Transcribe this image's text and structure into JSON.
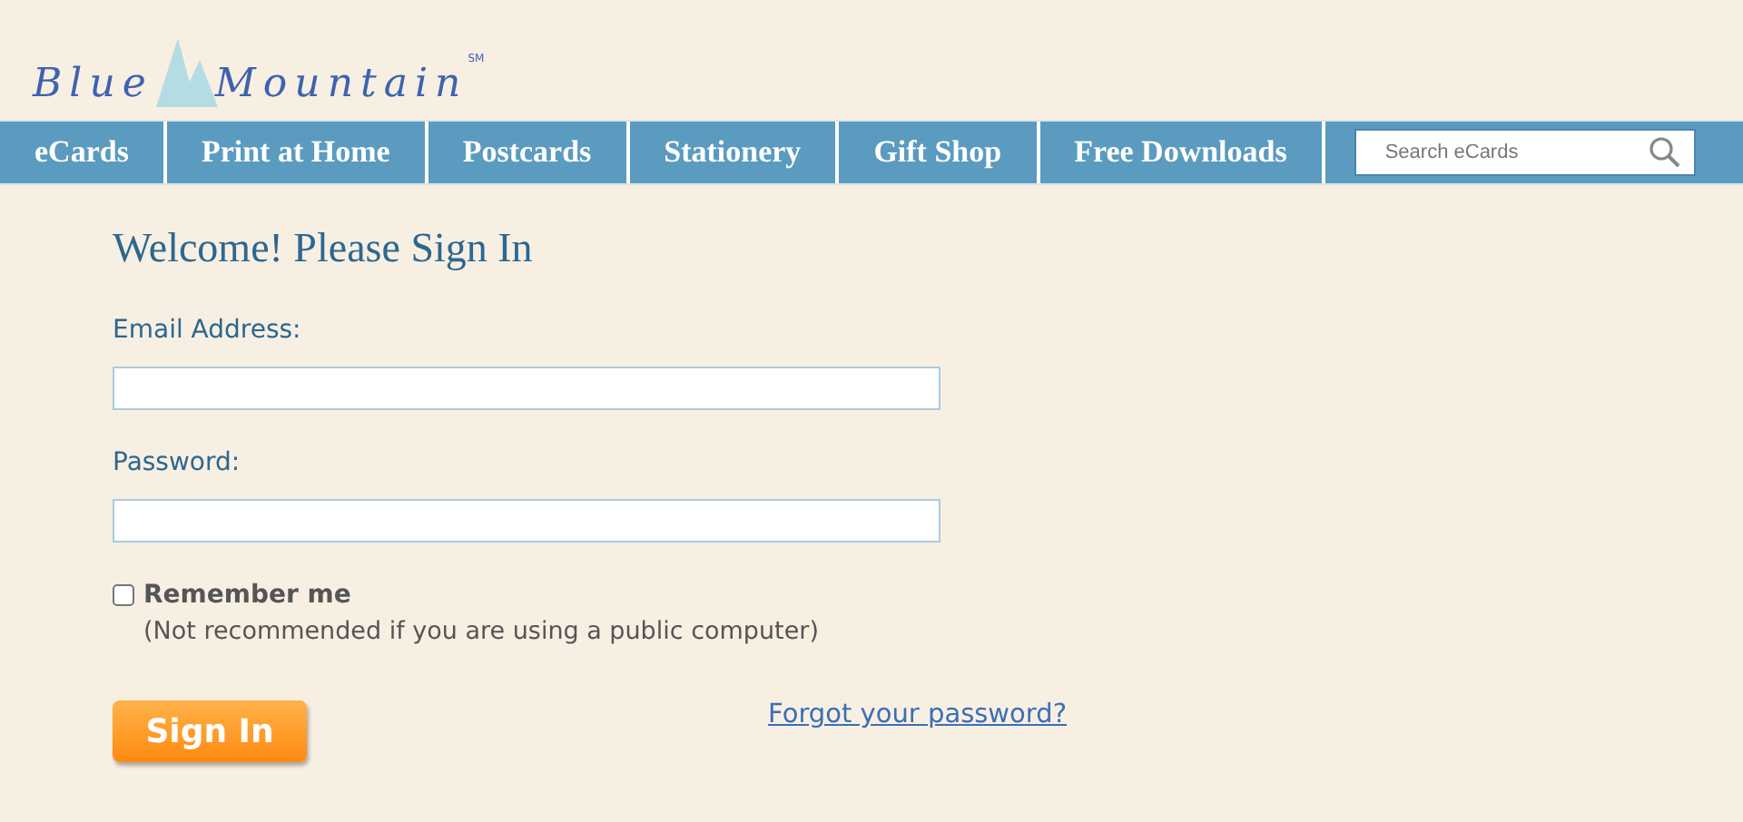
{
  "logo": {
    "name": "Blue Mountain",
    "mark": "SM"
  },
  "nav": {
    "items": [
      {
        "label": "eCards"
      },
      {
        "label": "Print at Home"
      },
      {
        "label": "Postcards"
      },
      {
        "label": "Stationery"
      },
      {
        "label": "Gift Shop"
      },
      {
        "label": "Free Downloads"
      }
    ],
    "search": {
      "placeholder": "Search eCards"
    }
  },
  "form": {
    "title": "Welcome! Please Sign In",
    "fields": [
      {
        "label": "Email Address:"
      },
      {
        "label": "Password:"
      }
    ],
    "remember": {
      "label": "Remember me",
      "checked": false,
      "note": "(Not recommended if you are using a public computer)"
    },
    "submit": "Sign In",
    "forgot": "Forgot your password?"
  }
}
